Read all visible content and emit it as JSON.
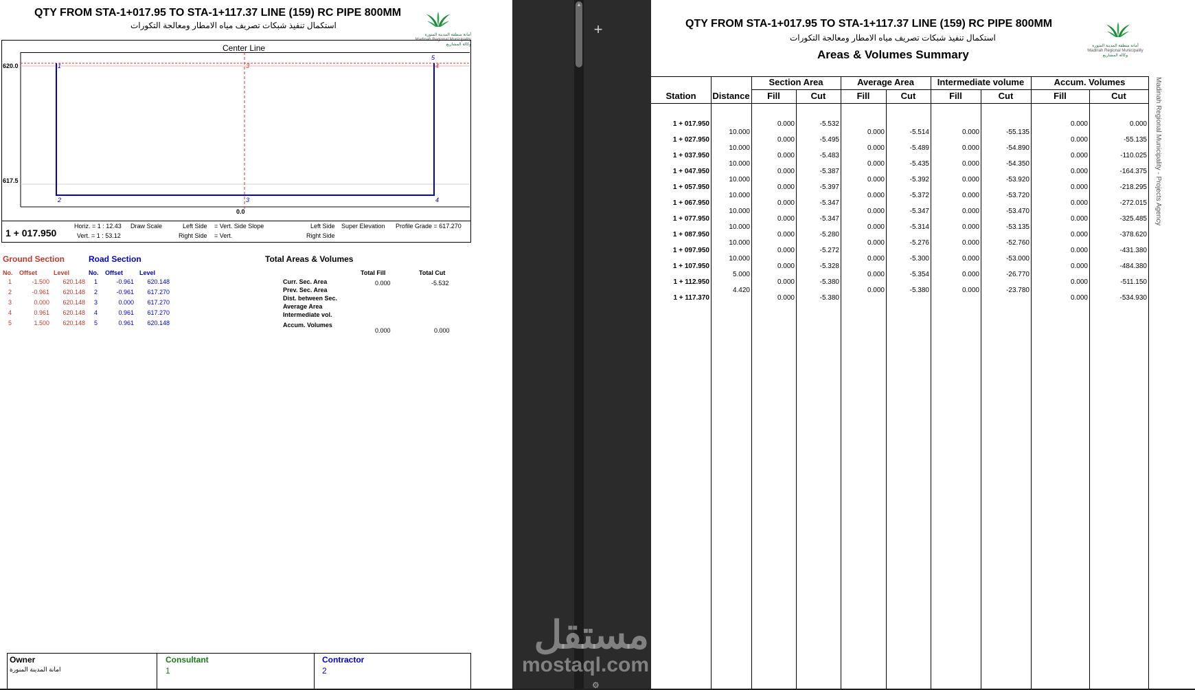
{
  "left": {
    "title": "QTY FROM STA-1+017.95 TO STA-1+117.37 LINE (159) RC PIPE 800MM",
    "subtitle_ar": "استكمال تنفيذ شبكات تصريف مياه الامطار ومعالجة التكورات",
    "logo_text_ar": "أمانة منطقة المدينة المنورة",
    "logo_text_en": "Madinah Regional Municipality",
    "logo_text_ar2": "وكالة المشاريع",
    "center_line_label": "Center Line",
    "y_labels": [
      "620.0",
      "617.5"
    ],
    "x_label": "0.0",
    "point_labels_top": [
      "1",
      "3",
      "4",
      "5"
    ],
    "point_labels_bottom": [
      "2",
      "3",
      "4"
    ],
    "station": "1 + 017.950",
    "scale": {
      "horiz": "Horiz. = 1 : 12.43",
      "draw_scale": "Draw Scale",
      "vert": "Vert. = 1 : 53.12",
      "left_side": "Left Side",
      "vert_side_slope": "= Vert.  Side Slope",
      "right_side": "Right Side",
      "right_vert": "= Vert.",
      "left_side2": "Left Side",
      "super_elevation": "Super Elevation",
      "right_side2": "Right Side",
      "profile_grade": "Profile Grade = 617.270"
    },
    "ground_section": {
      "title": "Ground Section",
      "headers": [
        "No.",
        "Offset",
        "Level"
      ],
      "rows": [
        [
          "1",
          "-1.500",
          "620.148"
        ],
        [
          "2",
          "-0.961",
          "620.148"
        ],
        [
          "3",
          "0.000",
          "620.148"
        ],
        [
          "4",
          "0.961",
          "620.148"
        ],
        [
          "5",
          "1.500",
          "620.148"
        ]
      ]
    },
    "road_section": {
      "title": "Road Section",
      "headers": [
        "No.",
        "Offset",
        "Level"
      ],
      "rows": [
        [
          "1",
          "-0.961",
          "620.148"
        ],
        [
          "2",
          "-0.961",
          "617.270"
        ],
        [
          "3",
          "0.000",
          "617.270"
        ],
        [
          "4",
          "0.961",
          "617.270"
        ],
        [
          "5",
          "0.961",
          "620.148"
        ]
      ]
    },
    "totals": {
      "title": "Total Areas & Volumes",
      "total_fill": "Total Fill",
      "total_cut": "Total Cut",
      "labels": [
        "Curr. Sec. Area",
        "Prev. Sec. Area",
        "Dist. between Sec.",
        "Average Area",
        "Intermediate vol.",
        "Accum. Volumes"
      ],
      "curr_fill": "0.000",
      "curr_cut": "-5.532",
      "accum_fill": "0.000",
      "accum_cut": "0.000"
    },
    "footer": {
      "owner_label": "Owner",
      "owner_value": "امانة المدينة المنورة",
      "consultant_label": "Consultant",
      "consultant_value": "1",
      "contractor_label": "Contractor",
      "contractor_value": "2"
    }
  },
  "right": {
    "title": "QTY FROM STA-1+017.95 TO STA-1+117.37 LINE (159) RC PIPE 800MM",
    "subtitle_ar": "استكمال تنفيذ شبكات تصريف مياه الامطار ومعالجة التكورات",
    "summary_title": "Areas & Volumes Summary",
    "side_text": "Madinah Regional Municipality - Projects Agency",
    "groups": [
      "Section Area",
      "Average Area",
      "Intermediate volume",
      "Accum. Volumes"
    ],
    "col_station": "Station",
    "col_distance": "Distance",
    "fill": "Fill",
    "cut": "Cut",
    "stations": [
      {
        "station": "1 + 017.950",
        "sa_fill": "0.000",
        "sa_cut": "-5.532",
        "acc_fill": "0.000",
        "acc_cut": "0.000"
      },
      {
        "station": "1 + 027.950",
        "sa_fill": "0.000",
        "sa_cut": "-5.495",
        "acc_fill": "0.000",
        "acc_cut": "-55.135"
      },
      {
        "station": "1 + 037.950",
        "sa_fill": "0.000",
        "sa_cut": "-5.483",
        "acc_fill": "0.000",
        "acc_cut": "-110.025"
      },
      {
        "station": "1 + 047.950",
        "sa_fill": "0.000",
        "sa_cut": "-5.387",
        "acc_fill": "0.000",
        "acc_cut": "-164.375"
      },
      {
        "station": "1 + 057.950",
        "sa_fill": "0.000",
        "sa_cut": "-5.397",
        "acc_fill": "0.000",
        "acc_cut": "-218.295"
      },
      {
        "station": "1 + 067.950",
        "sa_fill": "0.000",
        "sa_cut": "-5.347",
        "acc_fill": "0.000",
        "acc_cut": "-272.015"
      },
      {
        "station": "1 + 077.950",
        "sa_fill": "0.000",
        "sa_cut": "-5.347",
        "acc_fill": "0.000",
        "acc_cut": "-325.485"
      },
      {
        "station": "1 + 087.950",
        "sa_fill": "0.000",
        "sa_cut": "-5.280",
        "acc_fill": "0.000",
        "acc_cut": "-378.620"
      },
      {
        "station": "1 + 097.950",
        "sa_fill": "0.000",
        "sa_cut": "-5.272",
        "acc_fill": "0.000",
        "acc_cut": "-431.380"
      },
      {
        "station": "1 + 107.950",
        "sa_fill": "0.000",
        "sa_cut": "-5.328",
        "acc_fill": "0.000",
        "acc_cut": "-484.380"
      },
      {
        "station": "1 + 112.950",
        "sa_fill": "0.000",
        "sa_cut": "-5.380",
        "acc_fill": "0.000",
        "acc_cut": "-511.150"
      },
      {
        "station": "1 + 117.370",
        "sa_fill": "0.000",
        "sa_cut": "-5.380",
        "acc_fill": "0.000",
        "acc_cut": "-534.930"
      }
    ],
    "intervals": [
      {
        "distance": "10.000",
        "avg_fill": "0.000",
        "avg_cut": "-5.514",
        "iv_fill": "0.000",
        "iv_cut": "-55.135"
      },
      {
        "distance": "10.000",
        "avg_fill": "0.000",
        "avg_cut": "-5.489",
        "iv_fill": "0.000",
        "iv_cut": "-54.890"
      },
      {
        "distance": "10.000",
        "avg_fill": "0.000",
        "avg_cut": "-5.435",
        "iv_fill": "0.000",
        "iv_cut": "-54.350"
      },
      {
        "distance": "10.000",
        "avg_fill": "0.000",
        "avg_cut": "-5.392",
        "iv_fill": "0.000",
        "iv_cut": "-53.920"
      },
      {
        "distance": "10.000",
        "avg_fill": "0.000",
        "avg_cut": "-5.372",
        "iv_fill": "0.000",
        "iv_cut": "-53.720"
      },
      {
        "distance": "10.000",
        "avg_fill": "0.000",
        "avg_cut": "-5.347",
        "iv_fill": "0.000",
        "iv_cut": "-53.470"
      },
      {
        "distance": "10.000",
        "avg_fill": "0.000",
        "avg_cut": "-5.314",
        "iv_fill": "0.000",
        "iv_cut": "-53.135"
      },
      {
        "distance": "10.000",
        "avg_fill": "0.000",
        "avg_cut": "-5.276",
        "iv_fill": "0.000",
        "iv_cut": "-52.760"
      },
      {
        "distance": "10.000",
        "avg_fill": "0.000",
        "avg_cut": "-5.300",
        "iv_fill": "0.000",
        "iv_cut": "-53.000"
      },
      {
        "distance": "5.000",
        "avg_fill": "0.000",
        "avg_cut": "-5.354",
        "iv_fill": "0.000",
        "iv_cut": "-26.770"
      },
      {
        "distance": "4.420",
        "avg_fill": "0.000",
        "avg_cut": "-5.380",
        "iv_fill": "0.000",
        "iv_cut": "-23.780"
      }
    ]
  },
  "watermark": {
    "ar": "مستقل",
    "en": "mostaql.com"
  },
  "ui": {
    "plus": "+"
  },
  "colors": {
    "ground": "#c0392b",
    "road": "#0000cc",
    "consultant": "#1a7a1a",
    "logo": "#1e8a3c"
  }
}
